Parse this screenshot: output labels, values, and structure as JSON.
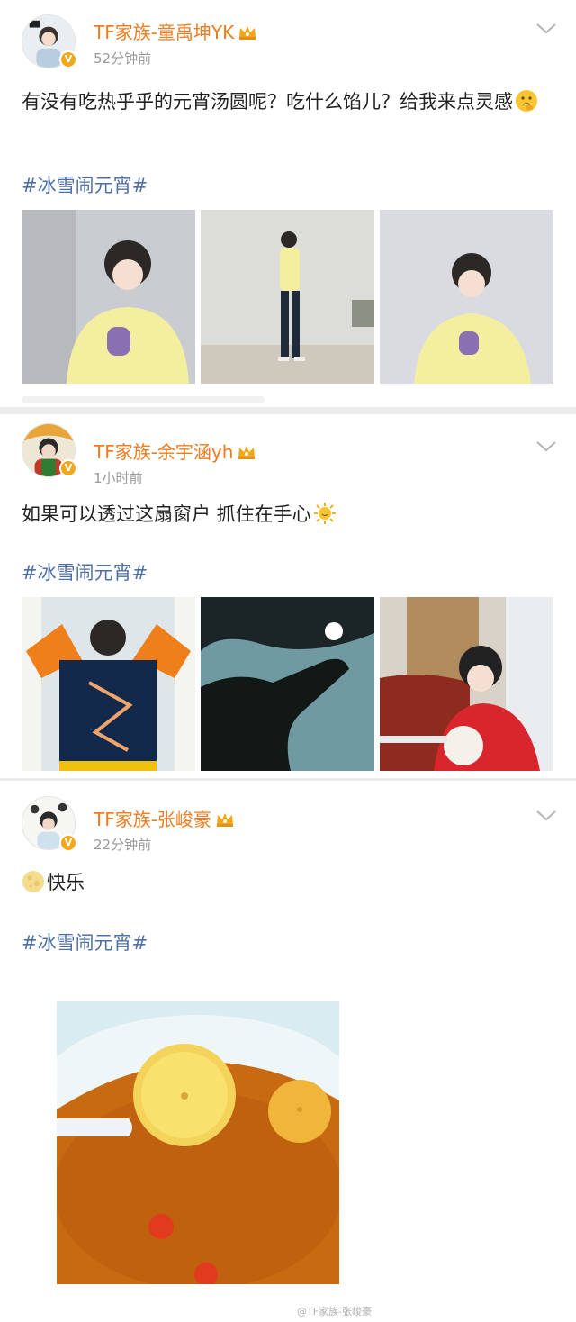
{
  "posts": [
    {
      "username": "TF家族-童禹坤YK",
      "time": "52分钟前",
      "text": "有没有吃热乎乎的元宵汤圆呢？吃什么馅儿？给我来点灵感",
      "text_emoji": "thinking-face-emoji",
      "hashtag": "#冰雪闹元宵#",
      "photos": [
        "yellow-sweater-portrait",
        "yellow-sweater-full-body",
        "yellow-sweater-closeup"
      ]
    },
    {
      "username": "TF家族-余宇涵yh",
      "time": "1小时前",
      "text": "如果可以透过这扇窗户 抓住在手心",
      "text_emoji": "sun-emoji",
      "hashtag": "#冰雪闹元宵#",
      "photos": [
        "orange-jacket-back",
        "hand-silhouette-sky",
        "red-jacket-tangyuan"
      ]
    },
    {
      "username": "TF家族-张峻豪",
      "time": "22分钟前",
      "text": "快乐",
      "text_emoji": "full-moon-emoji",
      "hashtag": "#冰雪闹元宵#",
      "photos": [
        "tangyuan-bowl"
      ]
    }
  ],
  "icons": {
    "verified": "v-badge-icon",
    "crown": "gold-crown-icon",
    "menu": "chevron-down-icon"
  },
  "colors": {
    "username": "#f07b1f",
    "hashtag": "#4f6fa8",
    "time": "#999999",
    "separator": "#ececec",
    "badge": "#f2a71b"
  },
  "watermark": "@TF家族-张峻豪"
}
